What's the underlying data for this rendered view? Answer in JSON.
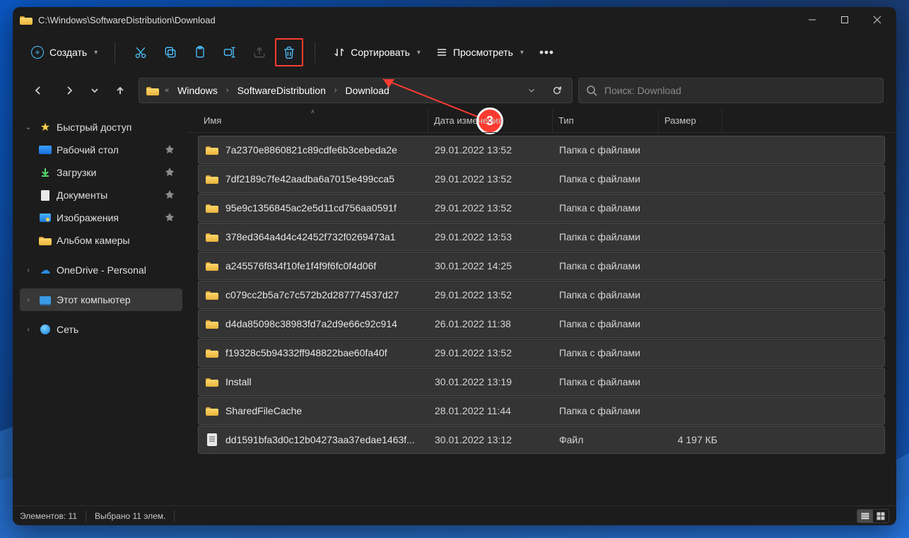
{
  "title_path": "C:\\Windows\\SoftwareDistribution\\Download",
  "toolbar": {
    "new_label": "Создать",
    "sort_label": "Сортировать",
    "view_label": "Просмотреть"
  },
  "breadcrumb": {
    "items": [
      "Windows",
      "SoftwareDistribution",
      "Download"
    ]
  },
  "search": {
    "placeholder": "Поиск: Download"
  },
  "sidebar": {
    "quick": "Быстрый доступ",
    "desktop": "Рабочий стол",
    "downloads": "Загрузки",
    "documents": "Документы",
    "pictures": "Изображения",
    "camera": "Альбом камеры",
    "onedrive": "OneDrive - Personal",
    "thispc": "Этот компьютер",
    "network": "Сеть"
  },
  "columns": {
    "name": "Имя",
    "date": "Дата изменения",
    "type": "Тип",
    "size": "Размер"
  },
  "rows": [
    {
      "name": "7a2370e8860821c89cdfe6b3cebeda2e",
      "date": "29.01.2022 13:52",
      "type": "Папка с файлами",
      "size": "",
      "kind": "folder"
    },
    {
      "name": "7df2189c7fe42aadba6a7015e499cca5",
      "date": "29.01.2022 13:52",
      "type": "Папка с файлами",
      "size": "",
      "kind": "folder"
    },
    {
      "name": "95e9c1356845ac2e5d11cd756aa0591f",
      "date": "29.01.2022 13:52",
      "type": "Папка с файлами",
      "size": "",
      "kind": "folder"
    },
    {
      "name": "378ed364a4d4c42452f732f0269473a1",
      "date": "29.01.2022 13:53",
      "type": "Папка с файлами",
      "size": "",
      "kind": "folder"
    },
    {
      "name": "a245576f834f10fe1f4f9f6fc0f4d06f",
      "date": "30.01.2022 14:25",
      "type": "Папка с файлами",
      "size": "",
      "kind": "folder"
    },
    {
      "name": "c079cc2b5a7c7c572b2d287774537d27",
      "date": "29.01.2022 13:52",
      "type": "Папка с файлами",
      "size": "",
      "kind": "folder"
    },
    {
      "name": "d4da85098c38983fd7a2d9e66c92c914",
      "date": "26.01.2022 11:38",
      "type": "Папка с файлами",
      "size": "",
      "kind": "folder"
    },
    {
      "name": "f19328c5b94332ff948822bae60fa40f",
      "date": "29.01.2022 13:52",
      "type": "Папка с файлами",
      "size": "",
      "kind": "folder"
    },
    {
      "name": "Install",
      "date": "30.01.2022 13:19",
      "type": "Папка с файлами",
      "size": "",
      "kind": "folder"
    },
    {
      "name": "SharedFileCache",
      "date": "28.01.2022 11:44",
      "type": "Папка с файлами",
      "size": "",
      "kind": "folder"
    },
    {
      "name": "dd1591bfa3d0c12b04273aa37edae1463f...",
      "date": "30.01.2022 13:12",
      "type": "Файл",
      "size": "4 197 КБ",
      "kind": "file"
    }
  ],
  "status": {
    "items": "Элементов: 11",
    "selected": "Выбрано 11 элем."
  },
  "annotation": {
    "number": "3"
  }
}
